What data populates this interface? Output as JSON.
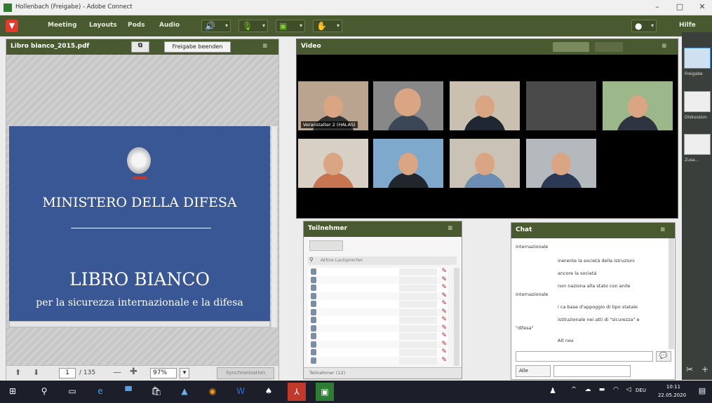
{
  "window": {
    "title": "Hollenbach (Freigabe) - Adobe Connect",
    "minimize": "–",
    "maximize": "□",
    "close": "✕"
  },
  "menubar": {
    "items": [
      "Meeting",
      "Layouts",
      "Pods",
      "Audio"
    ],
    "help": "Hilfe"
  },
  "share_pod": {
    "title": "Libro bianco_2015.pdf",
    "stop_button": "Freigabe beenden",
    "doc": {
      "ministry": "MINISTERO DELLA DIFESA",
      "title": "LIBRO BIANCO",
      "subtitle": "per la sicurezza internazionale e la difesa"
    },
    "footer": {
      "page": "1",
      "page_total": "/ 135",
      "zoom": "97%",
      "zoom_caret": "▾",
      "sync_button": "Synchronisation"
    }
  },
  "video_pod": {
    "title": "Video",
    "tiles": [
      {
        "name": "Veranstalter 2 (HALAS)"
      },
      {
        "name": ""
      },
      {
        "name": ""
      },
      {
        "name": ""
      },
      {
        "name": ""
      },
      {
        "name": ""
      },
      {
        "name": ""
      },
      {
        "name": ""
      },
      {
        "name": ""
      }
    ]
  },
  "participants_pod": {
    "title": "Teilnehmer",
    "filter_label": "Aktive Lautsprecher",
    "footer": "Teilnehmer (12)",
    "rows": 12
  },
  "chat_pod": {
    "title": "Chat",
    "lines": [
      "internazionale",
      "inerente la societá della istruzioni",
      "ancore la societá",
      "non naziona alla stato con anile",
      "internazionale",
      "i ca base d'appoggio di tipo statale",
      "istituzionale nei atti di \"sicurezza\" e",
      "\"difesa\"",
      "Alt nex"
    ],
    "recipient": "Alle",
    "send_icon": "speech-bubble-icon"
  },
  "right_rail": {
    "layouts": [
      "Freigabe",
      "Diskussion",
      "Zusa..."
    ]
  },
  "taskbar": {
    "lang": "DEU",
    "time": "10:11",
    "date": "22.05.2020"
  }
}
